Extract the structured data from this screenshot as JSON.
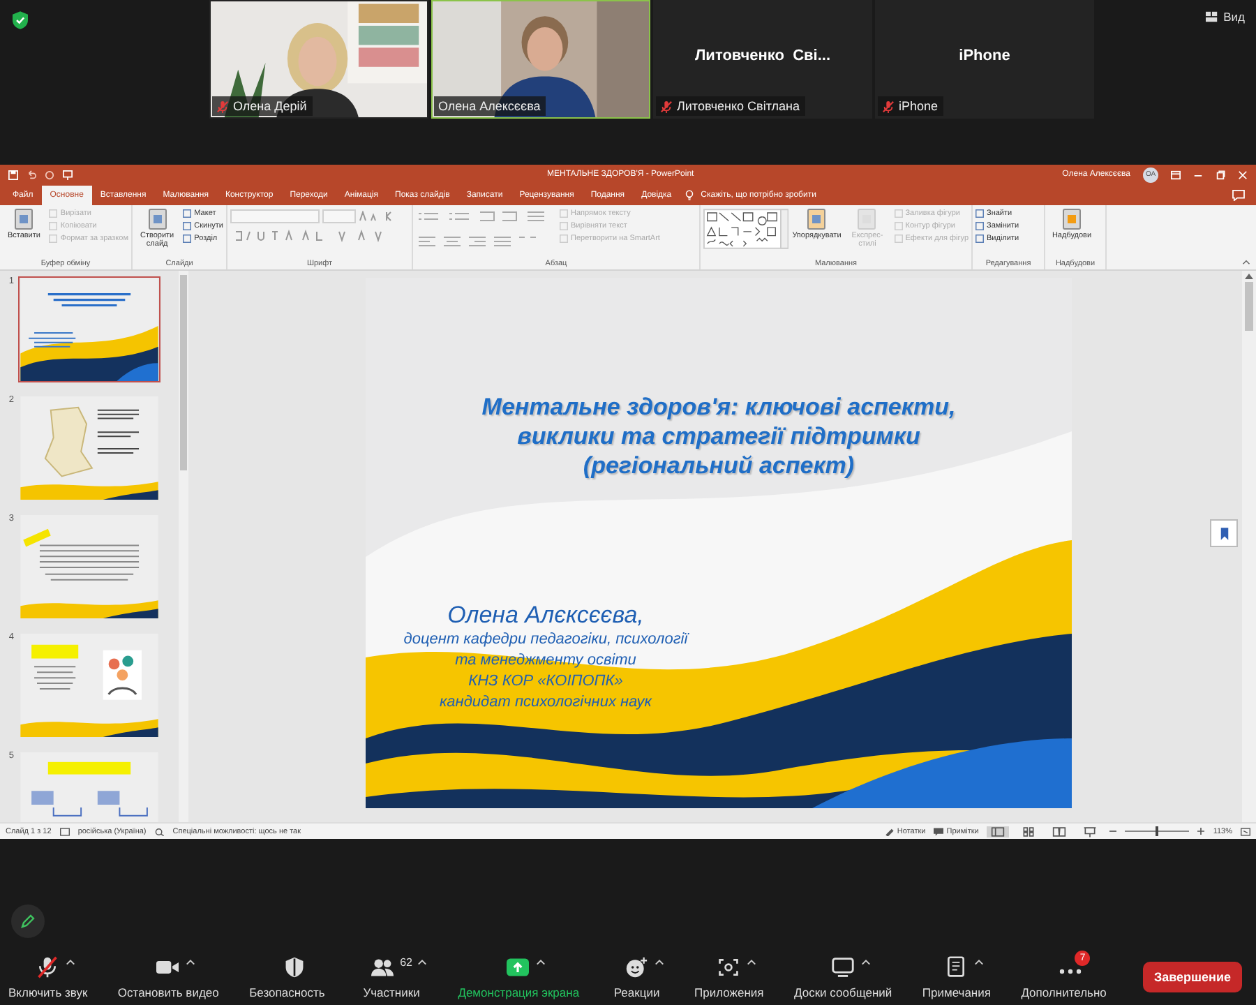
{
  "meeting": {
    "view_button": "Вид"
  },
  "participants": [
    {
      "name": "Олена Дерій",
      "kind": "video",
      "muted": true,
      "active_speaker": false
    },
    {
      "name": "Олена Алексєєва",
      "kind": "video",
      "muted": false,
      "active_speaker": true
    },
    {
      "name": "Литовченко Світлана",
      "kind": "name",
      "display": "Литовченко  Сві...",
      "muted": true,
      "active_speaker": false
    },
    {
      "name": "iPhone",
      "kind": "name",
      "display": "iPhone",
      "muted": true,
      "active_speaker": false
    }
  ],
  "powerpoint": {
    "title": "МЕНТАЛЬНЕ ЗДОРОВ'Я - PowerPoint",
    "user": "Олена Алексєєва",
    "avatar": "ОА",
    "tabs": [
      {
        "label": "Файл",
        "selected": false
      },
      {
        "label": "Основне",
        "selected": true
      },
      {
        "label": "Вставлення",
        "selected": false
      },
      {
        "label": "Малювання",
        "selected": false
      },
      {
        "label": "Конструктор",
        "selected": false
      },
      {
        "label": "Переходи",
        "selected": false
      },
      {
        "label": "Анімація",
        "selected": false
      },
      {
        "label": "Показ слайдів",
        "selected": false
      },
      {
        "label": "Записати",
        "selected": false
      },
      {
        "label": "Рецензування",
        "selected": false
      },
      {
        "label": "Подання",
        "selected": false
      },
      {
        "label": "Довідка",
        "selected": false
      }
    ],
    "tell_me": "Скажіть, що потрібно зробити",
    "ribbon": [
      {
        "name": "Буфер обміну",
        "kind": "plain",
        "items": [
          {
            "label": "Вставити",
            "kind": "large",
            "disabled": false
          },
          {
            "label": "Вирізати",
            "kind": "small",
            "disabled": true
          },
          {
            "label": "Копіювати",
            "kind": "small",
            "disabled": true
          },
          {
            "label": "Формат за зразком",
            "kind": "small",
            "disabled": true
          }
        ]
      },
      {
        "name": "Слайди",
        "kind": "plain",
        "items": [
          {
            "label": "Створити слайд",
            "kind": "large",
            "disabled": false
          },
          {
            "label": "Макет",
            "kind": "small",
            "disabled": false
          },
          {
            "label": "Скинути",
            "kind": "small",
            "disabled": false
          },
          {
            "label": "Розділ",
            "kind": "small",
            "disabled": false
          }
        ]
      },
      {
        "name": "Шрифт",
        "kind": "font"
      },
      {
        "name": "Абзац",
        "kind": "paragraph",
        "items": [
          {
            "label": "Напрямок тексту",
            "kind": "small",
            "disabled": true
          },
          {
            "label": "Вирівняти текст",
            "kind": "small",
            "disabled": true
          },
          {
            "label": "Перетворити на SmartArt",
            "kind": "small",
            "disabled": true
          }
        ]
      },
      {
        "name": "Малювання",
        "kind": "drawing",
        "items": [
          {
            "label": "Упорядкувати",
            "kind": "large",
            "disabled": false
          },
          {
            "label": "Експрес-стилі",
            "kind": "large",
            "disabled": true
          },
          {
            "label": "Заливка фігури",
            "kind": "small",
            "disabled": true
          },
          {
            "label": "Контур фігури",
            "kind": "small",
            "disabled": true
          },
          {
            "label": "Ефекти для фігур",
            "kind": "small",
            "disabled": true
          }
        ]
      },
      {
        "name": "Редагування",
        "kind": "plain",
        "items": [
          {
            "label": "Знайти",
            "kind": "small",
            "disabled": false
          },
          {
            "label": "Замінити",
            "kind": "small",
            "disabled": false
          },
          {
            "label": "Виділити",
            "kind": "small",
            "disabled": false
          }
        ]
      },
      {
        "name": "Надбудови",
        "kind": "plain",
        "items": [
          {
            "label": "Надбудови",
            "kind": "large",
            "disabled": false
          }
        ]
      }
    ],
    "thumbnails": [
      {
        "number": "1",
        "kind": "title",
        "selected": true
      },
      {
        "number": "2",
        "kind": "map",
        "selected": false
      },
      {
        "number": "3",
        "kind": "text",
        "selected": false
      },
      {
        "number": "4",
        "selected": false
      },
      {
        "number": "5",
        "kind": "goals",
        "selected": false
      }
    ],
    "slide": {
      "title": "Ментальне здоров'я: ключові аспекти, виклики та стратегії підтримки (регіональний аспект)",
      "author": "Олена Алєксєєва,",
      "author_lines": [
        "доцент кафедри педагогіки, психології",
        "та менеджменту освіти",
        "КНЗ КОР «КОІПОПК»",
        "кандидат психологічних наук"
      ]
    },
    "status_bar": {
      "slide": "Слайд 1 з 12",
      "language": "російська (Україна)",
      "accessibility": "Спеціальні можливості: щось не так",
      "notes": "Нотатки",
      "comments": "Примітки",
      "zoom_slider": {
        "level": 0.5
      },
      "zoom": "113%"
    }
  },
  "toolbar": {
    "buttons": [
      {
        "label": "Включить звук",
        "kind": "mic",
        "muted": true,
        "menu": true
      },
      {
        "label": "Остановить видео",
        "kind": "video",
        "menu": true
      },
      {
        "label": "Безопасность",
        "kind": "security",
        "menu": false
      },
      {
        "label": "Участники",
        "kind": "participants",
        "count": "62",
        "menu": true
      },
      {
        "label": "Демонстрация экрана",
        "kind": "share",
        "menu": true
      },
      {
        "label": "Реакции",
        "kind": "reactions",
        "menu": true
      },
      {
        "label": "Приложения",
        "kind": "apps",
        "menu": true
      },
      {
        "label": "Доски сообщений",
        "kind": "boards",
        "menu": true
      },
      {
        "label": "Примечания",
        "kind": "notes",
        "menu": true
      },
      {
        "label": "Дополнительно",
        "kind": "more",
        "badge": "7",
        "menu": false
      }
    ],
    "end_button": "Завершение"
  }
}
